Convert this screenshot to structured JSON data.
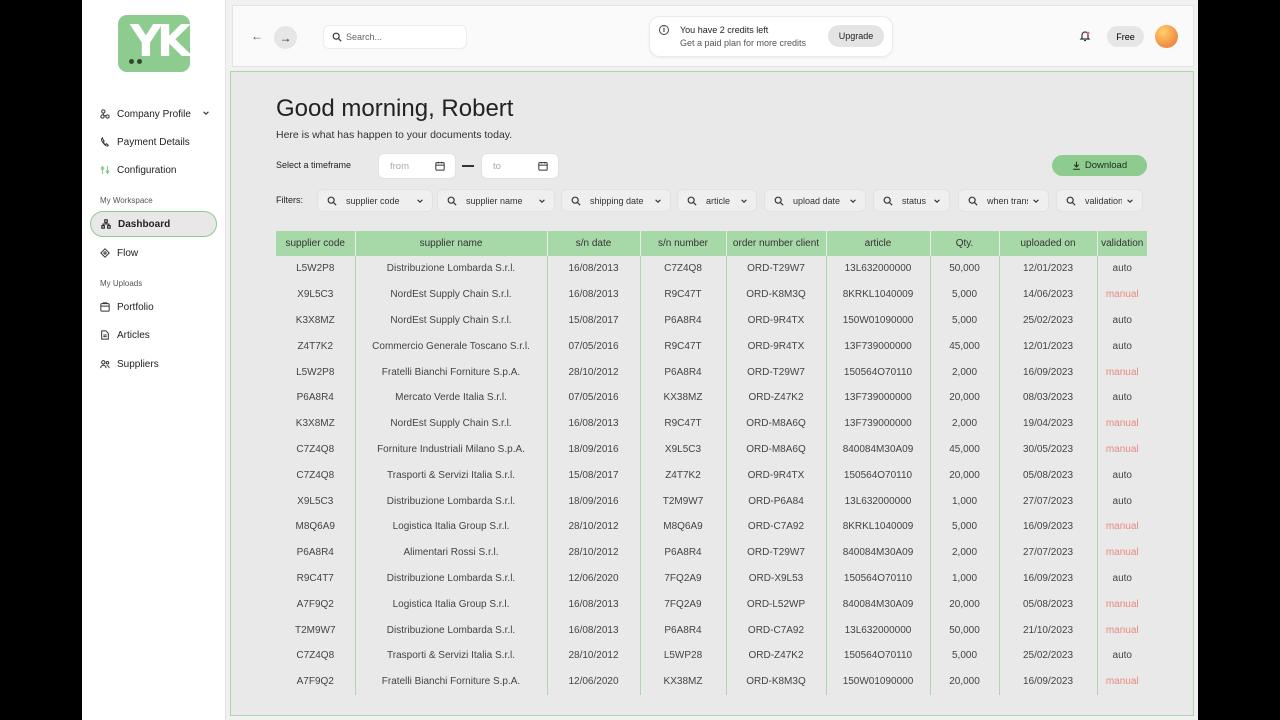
{
  "brand": {
    "logo_text": "YK"
  },
  "sidebar": {
    "items_top": [
      {
        "label": "Company Profile",
        "icon": "org-icon",
        "has_chevron": true
      },
      {
        "label": "Payment Details",
        "icon": "phone-icon"
      },
      {
        "label": "Configuration",
        "icon": "settings-icon"
      }
    ],
    "section_workspace": "My Workspace",
    "items_workspace": [
      {
        "label": "Dashboard",
        "icon": "dashboard-icon",
        "active": true
      },
      {
        "label": "Flow",
        "icon": "flow-icon"
      }
    ],
    "section_uploads": "My Uploads",
    "items_uploads": [
      {
        "label": "Portfolio",
        "icon": "portfolio-icon"
      },
      {
        "label": "Articles",
        "icon": "document-icon"
      },
      {
        "label": "Suppliers",
        "icon": "users-icon"
      }
    ]
  },
  "topbar": {
    "search_placeholder": "Search...",
    "credits_title": "You have 2 credits left",
    "credits_subtitle": "Get a paid plan for more credits",
    "upgrade_label": "Upgrade",
    "plan_label": "Free"
  },
  "main": {
    "greeting": "Good morning, Robert",
    "subtitle": "Here is what has happen to your documents today.",
    "timeframe_label": "Select a timeframe",
    "from_placeholder": "from",
    "to_placeholder": "to",
    "download_label": "Download",
    "filters_label": "Filters:",
    "filters": [
      "supplier code",
      "supplier name",
      "shipping date",
      "article",
      "upload date",
      "status",
      "when transferred",
      "validation"
    ]
  },
  "table": {
    "columns": [
      "supplier code",
      "supplier name",
      "s/n date",
      "s/n number",
      "order number client",
      "article",
      "Qty.",
      "uploaded on",
      "validation"
    ],
    "rows": [
      [
        "L5W2P8",
        "Distribuzione Lombarda S.r.l.",
        "16/08/2013",
        "C7Z4Q8",
        "ORD-T29W7",
        "13L632000000",
        "50,000",
        "12/01/2023",
        "auto"
      ],
      [
        "X9L5C3",
        "NordEst Supply Chain S.r.l.",
        "16/08/2013",
        "R9C47T",
        "ORD-K8M3Q",
        "8KRKL1040009",
        "5,000",
        "14/06/2023",
        "manual"
      ],
      [
        "K3X8MZ",
        "NordEst Supply Chain S.r.l.",
        "15/08/2017",
        "P6A8R4",
        "ORD-9R4TX",
        "150W01090000",
        "5,000",
        "25/02/2023",
        "auto"
      ],
      [
        "Z4T7K2",
        "Commercio Generale Toscano S.r.l.",
        "07/05/2016",
        "R9C47T",
        "ORD-9R4TX",
        "13F739000000",
        "45,000",
        "12/01/2023",
        "auto"
      ],
      [
        "L5W2P8",
        "Fratelli Bianchi Forniture S.p.A.",
        "28/10/2012",
        "P6A8R4",
        "ORD-T29W7",
        "150564O70110",
        "2,000",
        "16/09/2023",
        "manual"
      ],
      [
        "P6A8R4",
        "Mercato Verde Italia S.r.l.",
        "07/05/2016",
        "KX38MZ",
        "ORD-Z47K2",
        "13F739000000",
        "20,000",
        "08/03/2023",
        "auto"
      ],
      [
        "K3X8MZ",
        "NordEst Supply Chain S.r.l.",
        "16/08/2013",
        "R9C47T",
        "ORD-M8A6Q",
        "13F739000000",
        "2,000",
        "19/04/2023",
        "manual"
      ],
      [
        "C7Z4Q8",
        "Forniture Industriali Milano S.p.A.",
        "18/09/2016",
        "X9L5C3",
        "ORD-M8A6Q",
        "840084M30A09",
        "45,000",
        "30/05/2023",
        "manual"
      ],
      [
        "C7Z4Q8",
        "Trasporti & Servizi Italia S.r.l.",
        "15/08/2017",
        "Z4T7K2",
        "ORD-9R4TX",
        "150564O70110",
        "20,000",
        "05/08/2023",
        "auto"
      ],
      [
        "X9L5C3",
        "Distribuzione Lombarda S.r.l.",
        "18/09/2016",
        "T2M9W7",
        "ORD-P6A84",
        "13L632000000",
        "1,000",
        "27/07/2023",
        "auto"
      ],
      [
        "M8Q6A9",
        "Logistica Italia Group S.r.l.",
        "28/10/2012",
        "M8Q6A9",
        "ORD-C7A92",
        "8KRKL1040009",
        "5,000",
        "16/09/2023",
        "manual"
      ],
      [
        "P6A8R4",
        "Alimentari Rossi S.r.l.",
        "28/10/2012",
        "P6A8R4",
        "ORD-T29W7",
        "840084M30A09",
        "2,000",
        "27/07/2023",
        "manual"
      ],
      [
        "R9C4T7",
        "Distribuzione Lombarda S.r.l.",
        "12/06/2020",
        "7FQ2A9",
        "ORD-X9L53",
        "150564O70110",
        "1,000",
        "16/09/2023",
        "auto"
      ],
      [
        "A7F9Q2",
        "Logistica Italia Group S.r.l.",
        "16/08/2013",
        "7FQ2A9",
        "ORD-L52WP",
        "840084M30A09",
        "20,000",
        "05/08/2023",
        "manual"
      ],
      [
        "T2M9W7",
        "Distribuzione Lombarda S.r.l.",
        "16/08/2013",
        "P6A8R4",
        "ORD-C7A92",
        "13L632000000",
        "50,000",
        "21/10/2023",
        "manual"
      ],
      [
        "C7Z4Q8",
        "Trasporti & Servizi Italia S.r.l.",
        "28/10/2012",
        "L5WP28",
        "ORD-Z47K2",
        "150564O70110",
        "5,000",
        "25/02/2023",
        "auto"
      ],
      [
        "A7F9Q2",
        "Fratelli Bianchi Forniture S.p.A.",
        "12/06/2020",
        "KX38MZ",
        "ORD-K8M3Q",
        "150W01090000",
        "20,000",
        "16/09/2023",
        "manual"
      ]
    ]
  },
  "colors": {
    "accent": "#8dcb8e",
    "header": "#a7d8a8",
    "manual": "#e8897f"
  }
}
